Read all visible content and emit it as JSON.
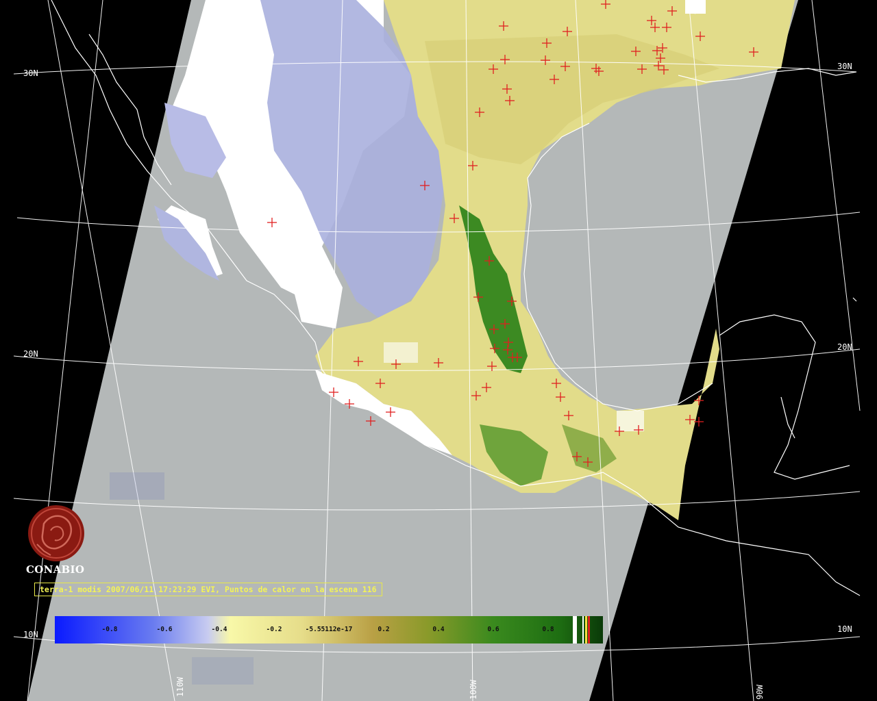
{
  "map": {
    "lat_labels": [
      "30N",
      "20N",
      "10N"
    ],
    "lon_labels": [
      "110W",
      "100W",
      "90W"
    ]
  },
  "logo": {
    "text": "CONABIO"
  },
  "caption": "terra-1 modis 2007/06/11 17:23:29 EVI, Puntos de calor en la escena 116",
  "colorbar": {
    "ticks": [
      "-0.8",
      "-0.6",
      "-0.4",
      "-0.2",
      "-5.55112e-17",
      "0.2",
      "0.4",
      "0.6",
      "0.8"
    ],
    "colors": [
      "#0a1aff",
      "#6a7cf0",
      "#c8ccf0",
      "#f8f8a8",
      "#e6dd8a",
      "#b9a045",
      "#8a9a2a",
      "#3a8a1e",
      "#1e6e12",
      "#0a3a08"
    ]
  },
  "colors": {
    "swath": "#b4b8b8",
    "cloud": "#ffffff",
    "hotspot": "#e02020",
    "caption": "#f4f455",
    "logo": "#8a1a12"
  }
}
